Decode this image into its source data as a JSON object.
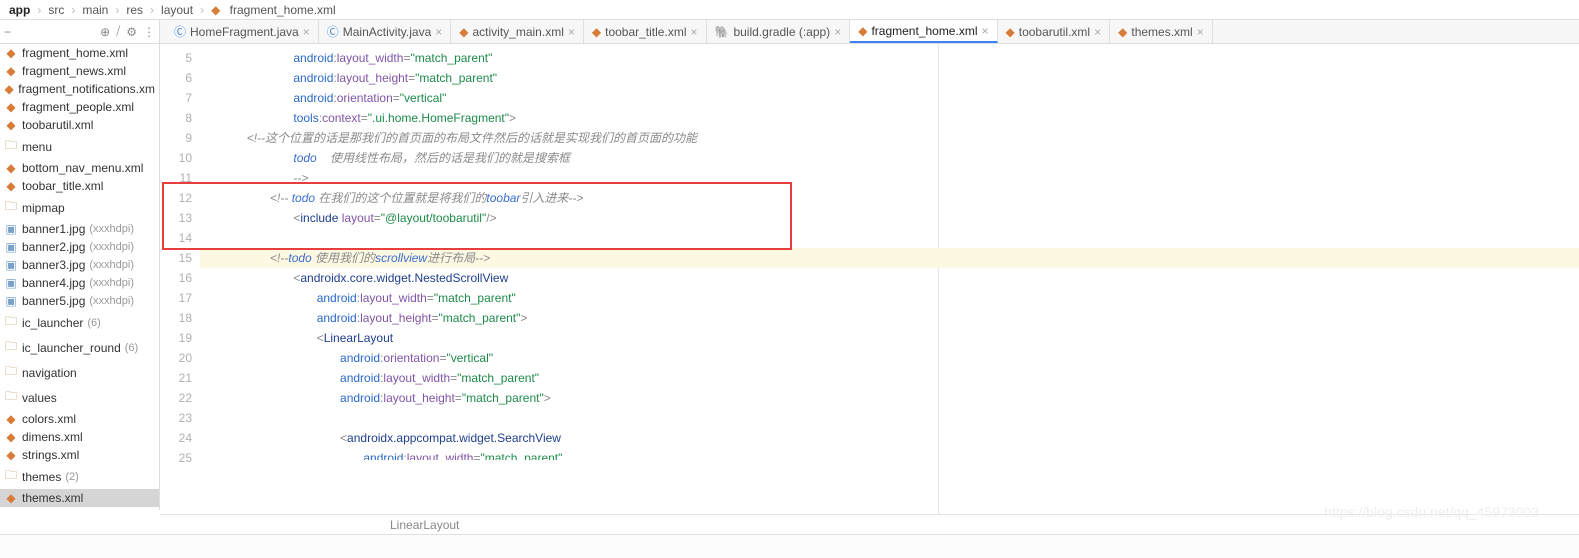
{
  "breadcrumbs": [
    "app",
    "src",
    "main",
    "res",
    "layout",
    "fragment_home.xml"
  ],
  "sidebar": {
    "icons": {
      "collapse": "−",
      "target": "⊕",
      "slash": "⧸",
      "gear": "⚙",
      "dots": "⋮"
    },
    "items": [
      {
        "label": "fragment_home.xml",
        "type": "xml"
      },
      {
        "label": "fragment_news.xml",
        "type": "xml"
      },
      {
        "label": "fragment_notifications.xm",
        "type": "xml"
      },
      {
        "label": "fragment_people.xml",
        "type": "xml"
      },
      {
        "label": "toobarutil.xml",
        "type": "xml"
      },
      {
        "label": "menu",
        "type": "folder"
      },
      {
        "label": "bottom_nav_menu.xml",
        "type": "xml"
      },
      {
        "label": "toobar_title.xml",
        "type": "xml"
      },
      {
        "label": "mipmap",
        "type": "folder"
      },
      {
        "label": "banner1.jpg",
        "type": "img",
        "hint": "(xxxhdpi)"
      },
      {
        "label": "banner2.jpg",
        "type": "img",
        "hint": "(xxxhdpi)"
      },
      {
        "label": "banner3.jpg",
        "type": "img",
        "hint": "(xxxhdpi)"
      },
      {
        "label": "banner4.jpg",
        "type": "img",
        "hint": "(xxxhdpi)"
      },
      {
        "label": "banner5.jpg",
        "type": "img",
        "hint": "(xxxhdpi)"
      },
      {
        "label": "ic_launcher",
        "type": "folder",
        "hint": "(6)"
      },
      {
        "label": "ic_launcher_round",
        "type": "folder",
        "hint": "(6)"
      },
      {
        "label": "navigation",
        "type": "folder"
      },
      {
        "label": "values",
        "type": "folder"
      },
      {
        "label": "colors.xml",
        "type": "xml"
      },
      {
        "label": "dimens.xml",
        "type": "xml"
      },
      {
        "label": "strings.xml",
        "type": "xml"
      },
      {
        "label": "themes",
        "type": "folder",
        "hint": "(2)"
      },
      {
        "label": "themes.xml",
        "type": "xml",
        "sel": true
      }
    ]
  },
  "tabs": [
    {
      "label": "HomeFragment.java",
      "icon": "java"
    },
    {
      "label": "MainActivity.java",
      "icon": "java"
    },
    {
      "label": "activity_main.xml",
      "icon": "xml"
    },
    {
      "label": "toobar_title.xml",
      "icon": "xml"
    },
    {
      "label": "build.gradle (:app)",
      "icon": "gradle"
    },
    {
      "label": "fragment_home.xml",
      "icon": "xml",
      "active": true
    },
    {
      "label": "toobarutil.xml",
      "icon": "xml"
    },
    {
      "label": "themes.xml",
      "icon": "xml"
    }
  ],
  "code": {
    "start": 5,
    "lines": [
      {
        "n": 5,
        "ind": 4,
        "seg": [
          [
            "ns",
            "android"
          ],
          [
            "punc",
            ":"
          ],
          [
            "attr",
            "layout_width"
          ],
          [
            "punc",
            "="
          ],
          [
            "str",
            "\"match_parent\""
          ]
        ]
      },
      {
        "n": 6,
        "ind": 4,
        "seg": [
          [
            "ns",
            "android"
          ],
          [
            "punc",
            ":"
          ],
          [
            "attr",
            "layout_height"
          ],
          [
            "punc",
            "="
          ],
          [
            "str",
            "\"match_parent\""
          ]
        ]
      },
      {
        "n": 7,
        "ind": 4,
        "seg": [
          [
            "ns",
            "android"
          ],
          [
            "punc",
            ":"
          ],
          [
            "attr",
            "orientation"
          ],
          [
            "punc",
            "="
          ],
          [
            "str",
            "\"vertical\""
          ]
        ]
      },
      {
        "n": 8,
        "ind": 4,
        "seg": [
          [
            "ns",
            "tools"
          ],
          [
            "punc",
            ":"
          ],
          [
            "attr",
            "context"
          ],
          [
            "punc",
            "="
          ],
          [
            "str",
            "\".ui.home.HomeFragment\""
          ],
          [
            "punc",
            ">"
          ]
        ]
      },
      {
        "n": 9,
        "ind": 2,
        "seg": [
          [
            "comment",
            "<!--这个位置的话是那我们的首页面的布局文件然后的话就是实现我们的首页面的功能"
          ]
        ]
      },
      {
        "n": 10,
        "ind": 4,
        "seg": [
          [
            "todo",
            "todo"
          ],
          [
            "comment",
            "    使用线性布局，然后的话是我们的就是搜索框"
          ]
        ]
      },
      {
        "n": 11,
        "ind": 4,
        "seg": [
          [
            "comment",
            "-->"
          ]
        ]
      },
      {
        "n": 12,
        "ind": 3,
        "seg": [
          [
            "comment",
            "<!-- "
          ],
          [
            "todo",
            "todo"
          ],
          [
            "comment",
            " 在我们的这个位置就是将我们的"
          ],
          [
            "todo",
            "toobar"
          ],
          [
            "comment",
            "引入进来-->"
          ]
        ]
      },
      {
        "n": 13,
        "ind": 4,
        "seg": [
          [
            "punc",
            "<"
          ],
          [
            "tag",
            "include"
          ],
          [
            "plain",
            " "
          ],
          [
            "attr",
            "layout"
          ],
          [
            "punc",
            "="
          ],
          [
            "str",
            "\"@layout/toobarutil\""
          ],
          [
            "punc",
            "/>"
          ]
        ]
      },
      {
        "n": 14,
        "ind": 0,
        "seg": []
      },
      {
        "n": 15,
        "ind": 3,
        "hl": true,
        "seg": [
          [
            "comment",
            "<!--"
          ],
          [
            "todo",
            "todo"
          ],
          [
            "comment",
            " 使用我们的"
          ],
          [
            "todo",
            "scrollview"
          ],
          [
            "comment",
            "进行布局-->"
          ]
        ]
      },
      {
        "n": 16,
        "ind": 4,
        "seg": [
          [
            "punc",
            "<"
          ],
          [
            "tag",
            "androidx.core.widget.NestedScrollView"
          ]
        ]
      },
      {
        "n": 17,
        "ind": 5,
        "seg": [
          [
            "ns",
            "android"
          ],
          [
            "punc",
            ":"
          ],
          [
            "attr",
            "layout_width"
          ],
          [
            "punc",
            "="
          ],
          [
            "str",
            "\"match_parent\""
          ]
        ]
      },
      {
        "n": 18,
        "ind": 5,
        "seg": [
          [
            "ns",
            "android"
          ],
          [
            "punc",
            ":"
          ],
          [
            "attr",
            "layout_height"
          ],
          [
            "punc",
            "="
          ],
          [
            "str",
            "\"match_parent\""
          ],
          [
            "punc",
            ">"
          ]
        ]
      },
      {
        "n": 19,
        "ind": 5,
        "seg": [
          [
            "punc",
            "<"
          ],
          [
            "tag",
            "LinearLayout"
          ]
        ]
      },
      {
        "n": 20,
        "ind": 6,
        "seg": [
          [
            "ns",
            "android"
          ],
          [
            "punc",
            ":"
          ],
          [
            "attr",
            "orientation"
          ],
          [
            "punc",
            "="
          ],
          [
            "str",
            "\"vertical\""
          ]
        ]
      },
      {
        "n": 21,
        "ind": 6,
        "seg": [
          [
            "ns",
            "android"
          ],
          [
            "punc",
            ":"
          ],
          [
            "attr",
            "layout_width"
          ],
          [
            "punc",
            "="
          ],
          [
            "str",
            "\"match_parent\""
          ]
        ]
      },
      {
        "n": 22,
        "ind": 6,
        "seg": [
          [
            "ns",
            "android"
          ],
          [
            "punc",
            ":"
          ],
          [
            "attr",
            "layout_height"
          ],
          [
            "punc",
            "="
          ],
          [
            "str",
            "\"match_parent\""
          ],
          [
            "punc",
            ">"
          ]
        ]
      },
      {
        "n": 23,
        "ind": 0,
        "seg": []
      },
      {
        "n": 24,
        "ind": 6,
        "seg": [
          [
            "punc",
            "<"
          ],
          [
            "tag",
            "androidx.appcompat.widget.SearchView"
          ]
        ]
      },
      {
        "n": 25,
        "ind": 7,
        "cut": true,
        "seg": [
          [
            "ns",
            "android"
          ],
          [
            "punc",
            ":"
          ],
          [
            "attr",
            "layout_width"
          ],
          [
            "punc",
            "="
          ],
          [
            "str",
            "\"match_parent\""
          ]
        ]
      }
    ],
    "bottom_crumb": "LinearLayout"
  },
  "watermark": "https://blog.csdn.net/qq_45973003"
}
